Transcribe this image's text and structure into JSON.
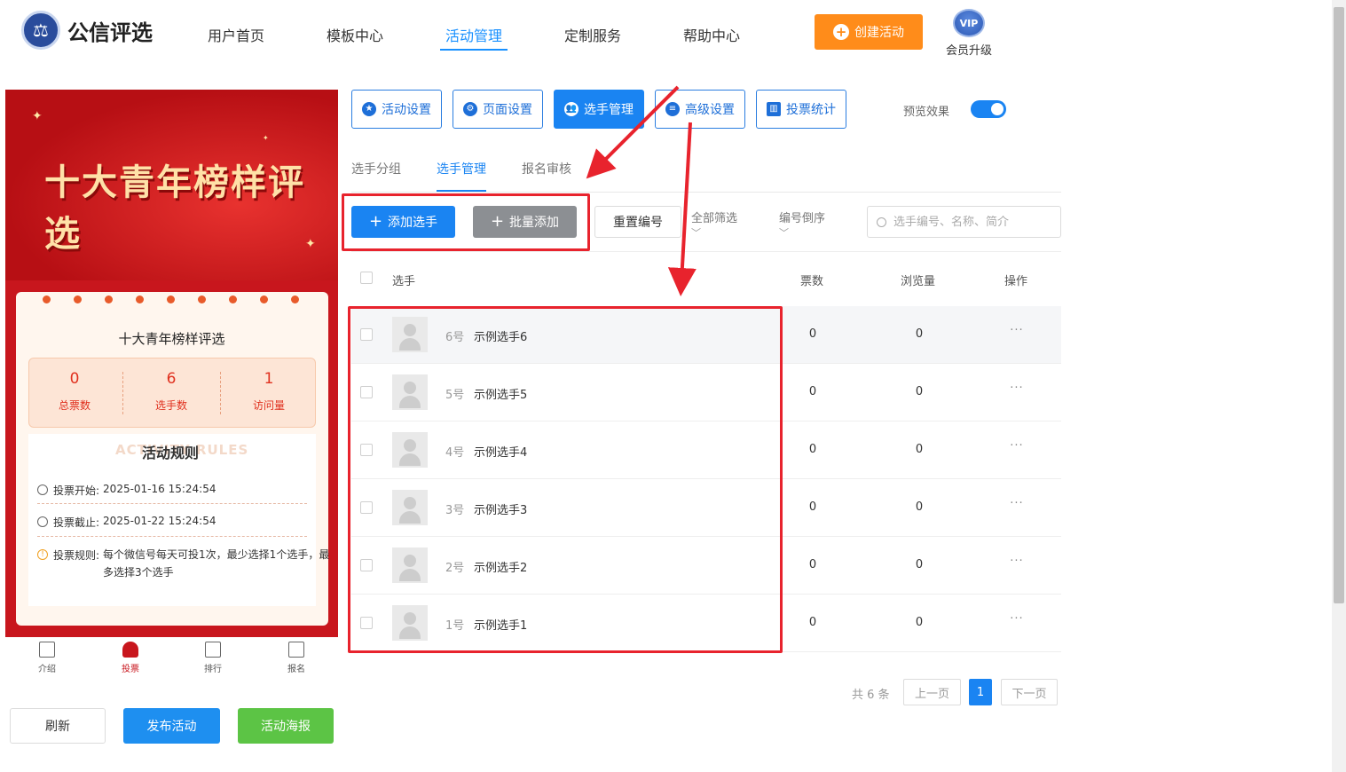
{
  "header": {
    "brand": "公信评选",
    "nav": [
      "用户首页",
      "模板中心",
      "活动管理",
      "定制服务",
      "帮助中心"
    ],
    "active_nav": "活动管理",
    "create_label": "创建活动",
    "vip_badge": "VIP",
    "vip_label": "会员升级"
  },
  "phone": {
    "banner_title": "十大青年榜样评选",
    "card_title": "十大青年榜样评选",
    "stats": [
      {
        "value": "0",
        "label": "总票数"
      },
      {
        "value": "6",
        "label": "选手数"
      },
      {
        "value": "1",
        "label": "访问量"
      }
    ],
    "rules_watermark": "ACTIVITY RULES",
    "rules_title": "活动规则",
    "rules": [
      {
        "label": "投票开始:",
        "value": "2025-01-16 15:24:54"
      },
      {
        "label": "投票截止:",
        "value": "2025-01-22 15:24:54"
      },
      {
        "label": "投票规则:",
        "value": "每个微信号每天可投1次，最少选择1个选手，最多选择3个选手"
      }
    ],
    "bottom_nav": [
      {
        "label": "介绍",
        "icon": "document-icon"
      },
      {
        "label": "投票",
        "icon": "person-icon"
      },
      {
        "label": "排行",
        "icon": "bars-icon"
      },
      {
        "label": "报名",
        "icon": "badge-icon"
      }
    ],
    "active_bottom_nav": "投票"
  },
  "actions": {
    "refresh": "刷新",
    "publish": "发布活动",
    "poster": "活动海报"
  },
  "tools": [
    {
      "label": "活动设置",
      "icon": "star-icon"
    },
    {
      "label": "页面设置",
      "icon": "gear-icon"
    },
    {
      "label": "选手管理",
      "icon": "users-icon"
    },
    {
      "label": "高级设置",
      "icon": "sliders-icon"
    },
    {
      "label": "投票统计",
      "icon": "chart-icon"
    }
  ],
  "active_tool": "选手管理",
  "preview": {
    "label": "预览效果",
    "enabled": true
  },
  "subtabs": [
    "选手分组",
    "选手管理",
    "报名审核"
  ],
  "active_subtab": "选手管理",
  "toolbar": {
    "add": "添加选手",
    "batch": "批量添加",
    "reset": "重置编号",
    "filter": "全部筛选",
    "sort": "编号倒序",
    "search_placeholder": "选手编号、名称、简介"
  },
  "table": {
    "columns": [
      "选手",
      "票数",
      "浏览量",
      "操作"
    ],
    "rows": [
      {
        "num": "6号",
        "name": "示例选手6",
        "votes": "0",
        "views": "0",
        "more": "···"
      },
      {
        "num": "5号",
        "name": "示例选手5",
        "votes": "0",
        "views": "0",
        "more": "···"
      },
      {
        "num": "4号",
        "name": "示例选手4",
        "votes": "0",
        "views": "0",
        "more": "···"
      },
      {
        "num": "3号",
        "name": "示例选手3",
        "votes": "0",
        "views": "0",
        "more": "···"
      },
      {
        "num": "2号",
        "name": "示例选手2",
        "votes": "0",
        "views": "0",
        "more": "···"
      },
      {
        "num": "1号",
        "name": "示例选手1",
        "votes": "0",
        "views": "0",
        "more": "···"
      }
    ]
  },
  "pagination": {
    "total": "共 6 条",
    "prev": "上一页",
    "current": "1",
    "next": "下一页"
  },
  "colors": {
    "primary": "#1a84f2",
    "orange": "#ff8c1a",
    "annotation_red": "#e8232d",
    "phone_red": "#c8161d"
  }
}
